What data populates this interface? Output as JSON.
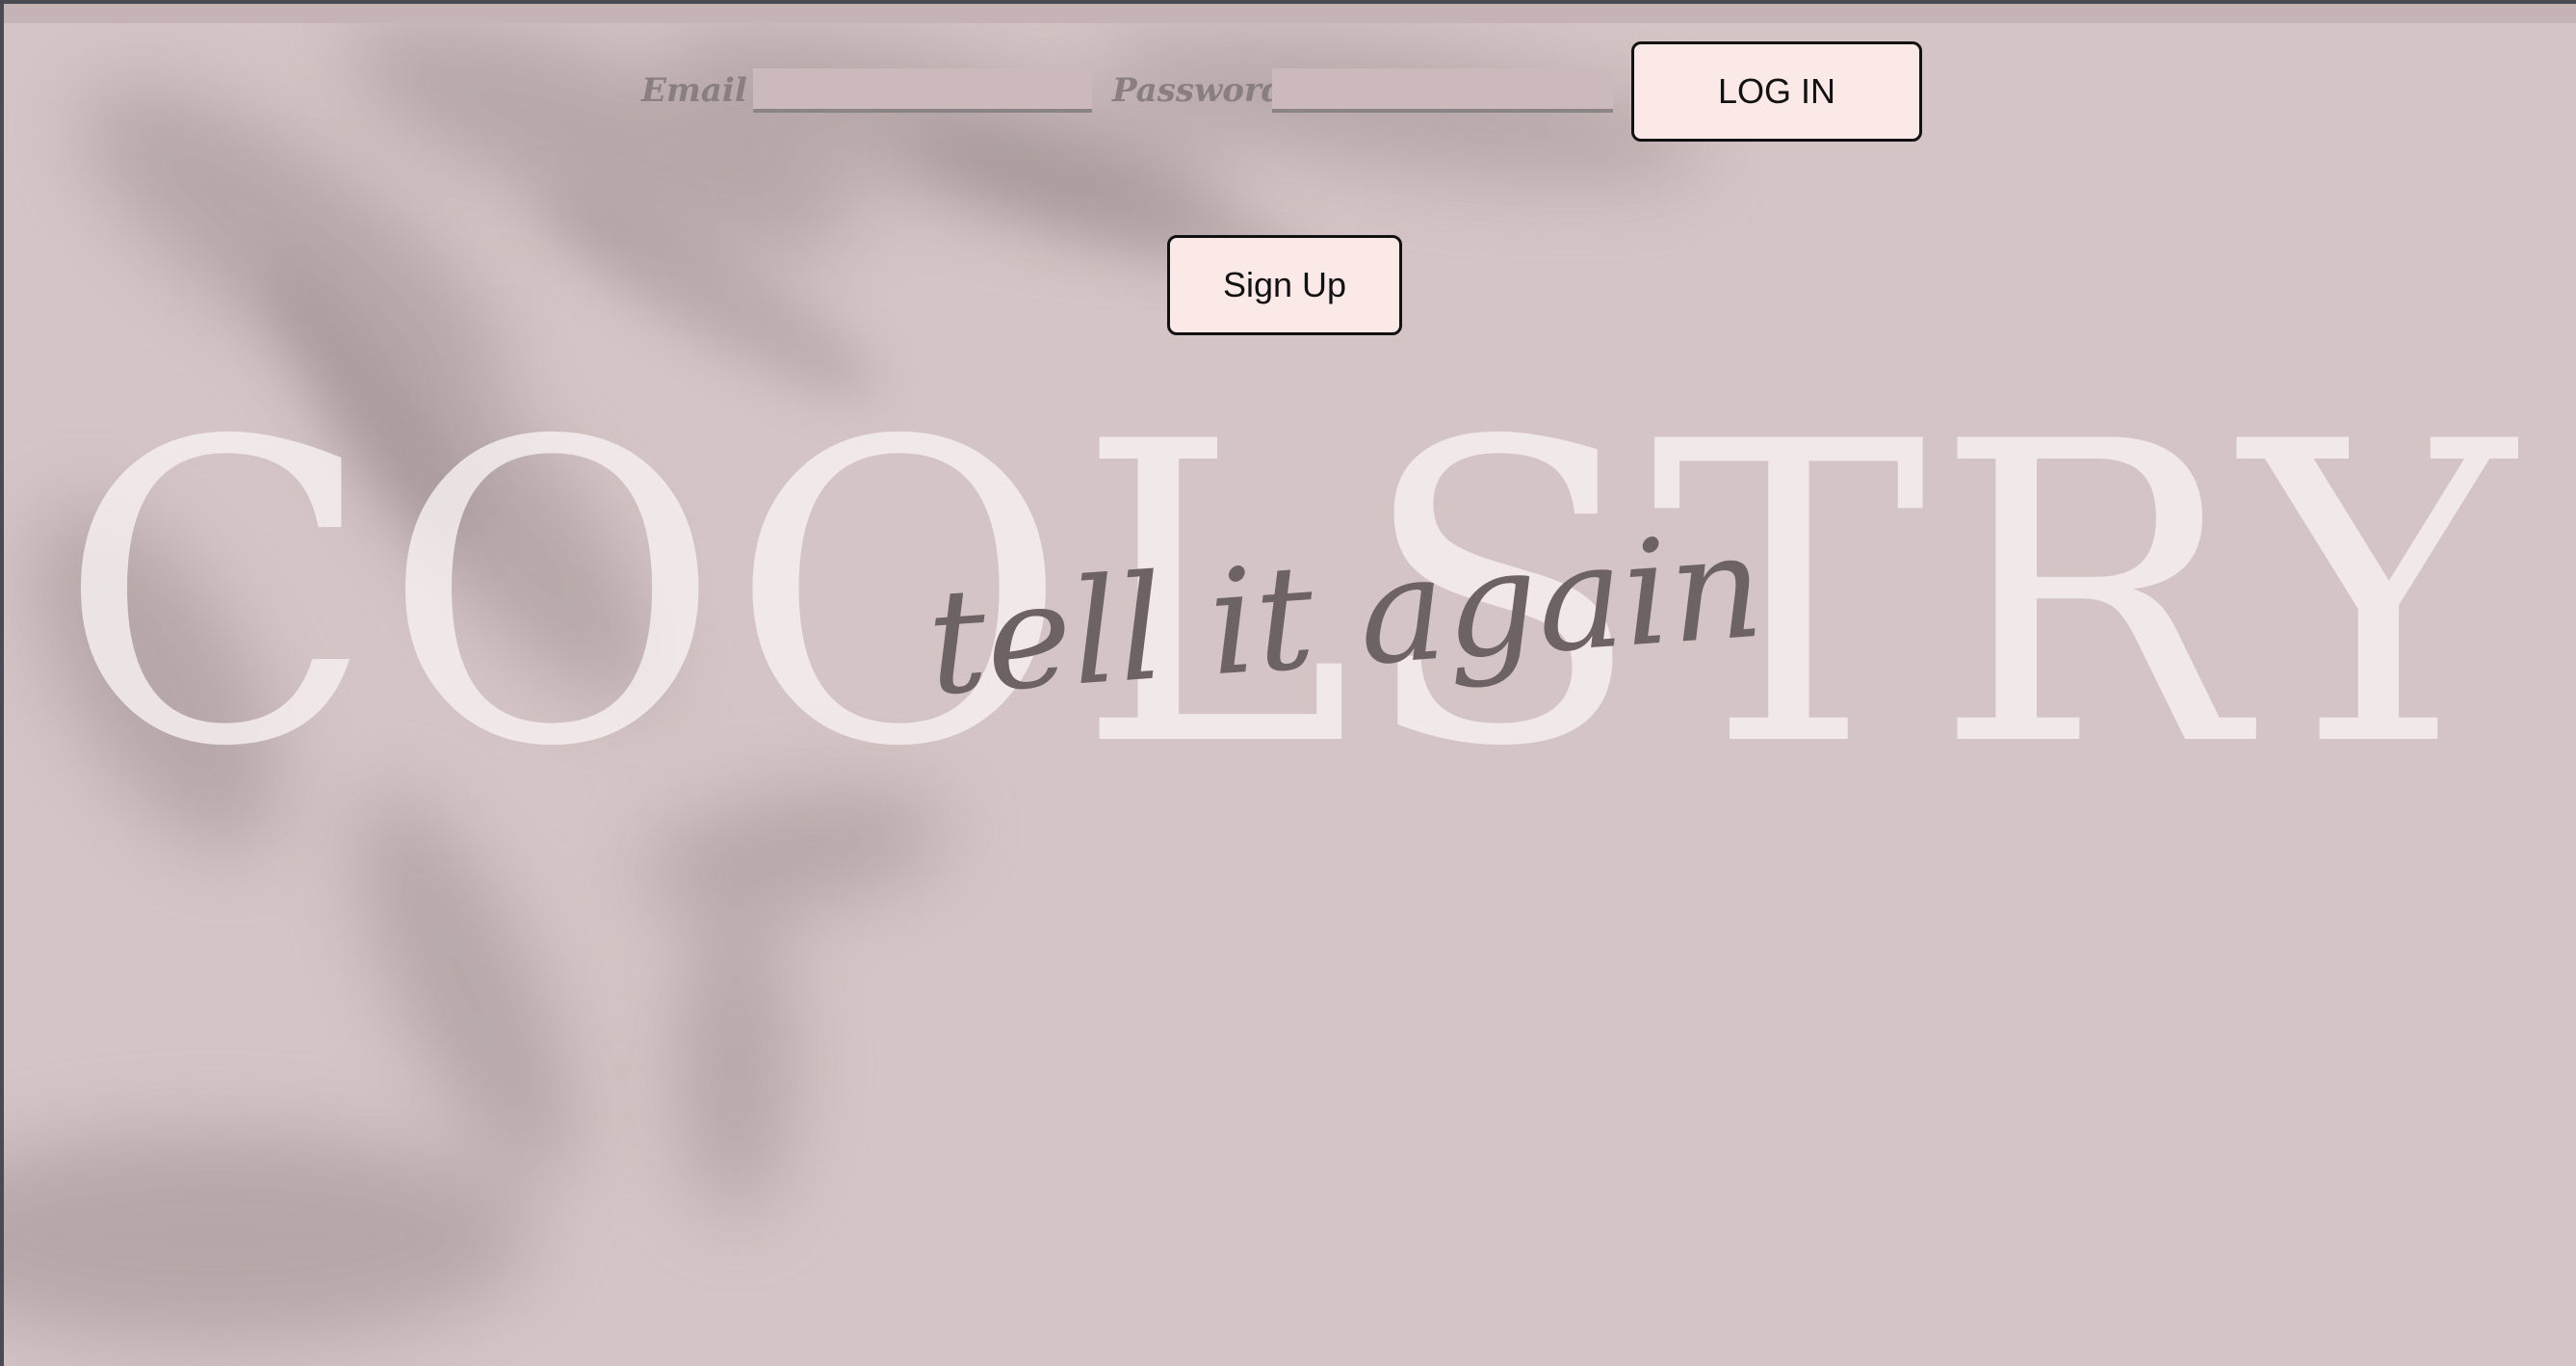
{
  "login": {
    "email_label": "Email",
    "email_value": "",
    "password_label": "Password",
    "password_value": "",
    "login_button": "LOG IN"
  },
  "signup": {
    "button": "Sign Up"
  },
  "hero": {
    "brand_logo": "COOLSTRY",
    "tagline": "tell it again"
  },
  "colors": {
    "background": "#d5c4c5",
    "button_fill": "#fbe9e8",
    "label_text": "#8a7f80",
    "tagline_text": "#6e6364"
  }
}
